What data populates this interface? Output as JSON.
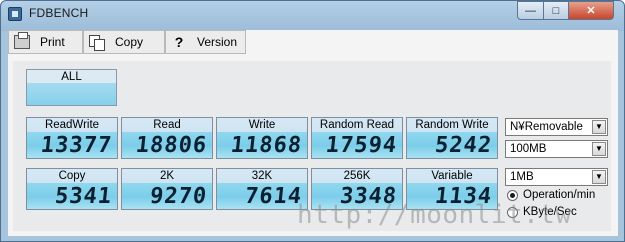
{
  "window": {
    "title": "FDBENCH"
  },
  "window_controls": {
    "minimize": "—",
    "maximize": "□",
    "close": "✕"
  },
  "menu": {
    "items": [
      {
        "label": "Print",
        "icon": "printer-icon"
      },
      {
        "label": "Copy",
        "icon": "copy-icon"
      },
      {
        "label": "Version",
        "icon": "help-icon"
      }
    ]
  },
  "all_button": {
    "label": "ALL"
  },
  "tiles_row1": [
    {
      "label": "ReadWrite",
      "value": "13377"
    },
    {
      "label": "Read",
      "value": "18806"
    },
    {
      "label": "Write",
      "value": "11868"
    },
    {
      "label": "Random Read",
      "value": "17594"
    },
    {
      "label": "Random Write",
      "value": "5242"
    }
  ],
  "tiles_row2": [
    {
      "label": "Copy",
      "value": "5341"
    },
    {
      "label": "2K",
      "value": "9270"
    },
    {
      "label": "32K",
      "value": "7614"
    },
    {
      "label": "256K",
      "value": "3348"
    },
    {
      "label": "Variable",
      "value": "1134"
    }
  ],
  "drive_select": {
    "value": "N¥Removable"
  },
  "size_select": {
    "value": "100MB"
  },
  "block_select": {
    "value": "1MB"
  },
  "units": {
    "options": [
      {
        "label": "Operation/min",
        "selected": true
      },
      {
        "label": "KByte/Sec",
        "selected": false
      }
    ]
  },
  "watermark": "http://moonlit.tw"
}
